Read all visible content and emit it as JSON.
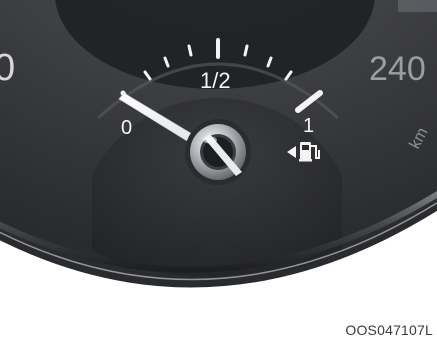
{
  "gauge": {
    "type": "fuel-gauge",
    "label_empty": "0",
    "label_half": "1/2",
    "label_full": "1",
    "needle_level": 0.0,
    "icon": "fuel-pump-icon",
    "icon_side_arrow": "filler-side-arrow-left"
  },
  "speedometer": {
    "left_partial_number": "0",
    "right_number": "240",
    "unit_partial": "km"
  },
  "figure_code": "OOS047107L",
  "colors": {
    "bezel": "#3c3d41",
    "face": "#2e2f32",
    "ink": "#f4f4f4",
    "background": "#ffffff"
  }
}
